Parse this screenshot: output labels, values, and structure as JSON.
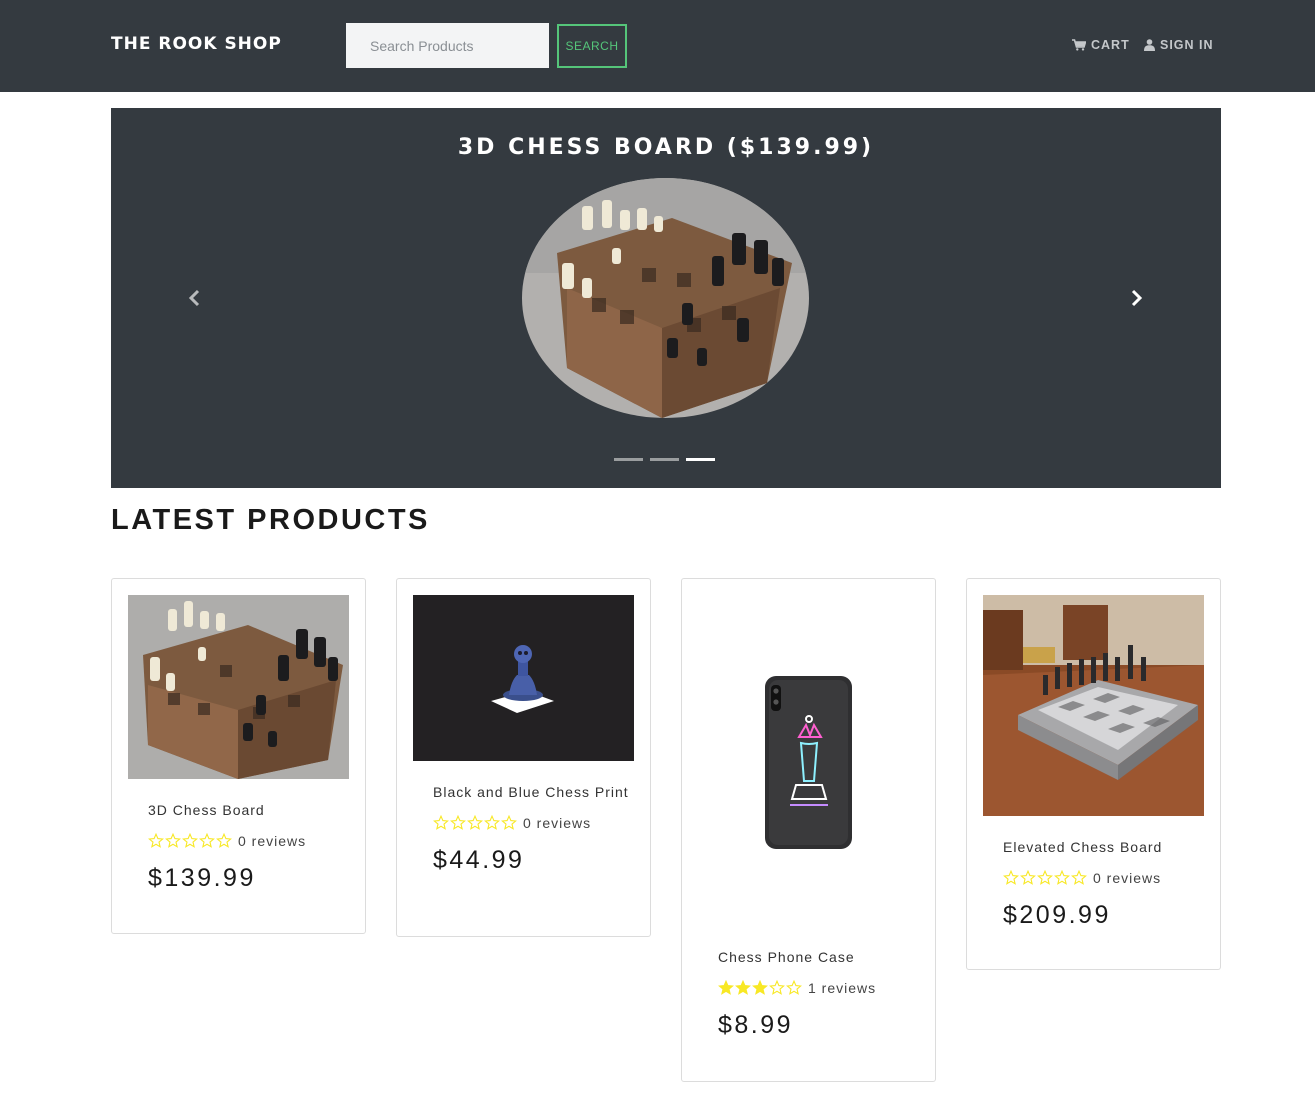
{
  "header": {
    "brand": "THE ROOK SHOP",
    "search_placeholder": "Search Products",
    "search_button": "SEARCH",
    "cart_label": "CART",
    "signin_label": "SIGN IN"
  },
  "carousel": {
    "caption": "3D CHESS BOARD ($139.99)",
    "prev_icon": "chevron-left-icon",
    "next_icon": "chevron-right-icon",
    "slide_count": 3,
    "active_slide": 3
  },
  "main": {
    "section_title": "LATEST PRODUCTS",
    "products": [
      {
        "name": "3D Chess Board",
        "rating": 0,
        "reviews": "0 reviews",
        "price": "$139.99",
        "image": "3d-chess-board-image"
      },
      {
        "name": "Black and Blue Chess Print",
        "rating": 0,
        "reviews": "0 reviews",
        "price": "$44.99",
        "image": "chess-print-image"
      },
      {
        "name": "Chess Phone Case",
        "rating": 3,
        "reviews": "1 reviews",
        "price": "$8.99",
        "image": "phone-case-image"
      },
      {
        "name": "Elevated Chess Board",
        "rating": 0,
        "reviews": "0 reviews",
        "price": "$209.99",
        "image": "elevated-chess-board-image"
      }
    ]
  },
  "colors": {
    "navbar_bg": "#343a40",
    "accent_green": "#55c57a",
    "star_yellow": "#f8e825"
  }
}
